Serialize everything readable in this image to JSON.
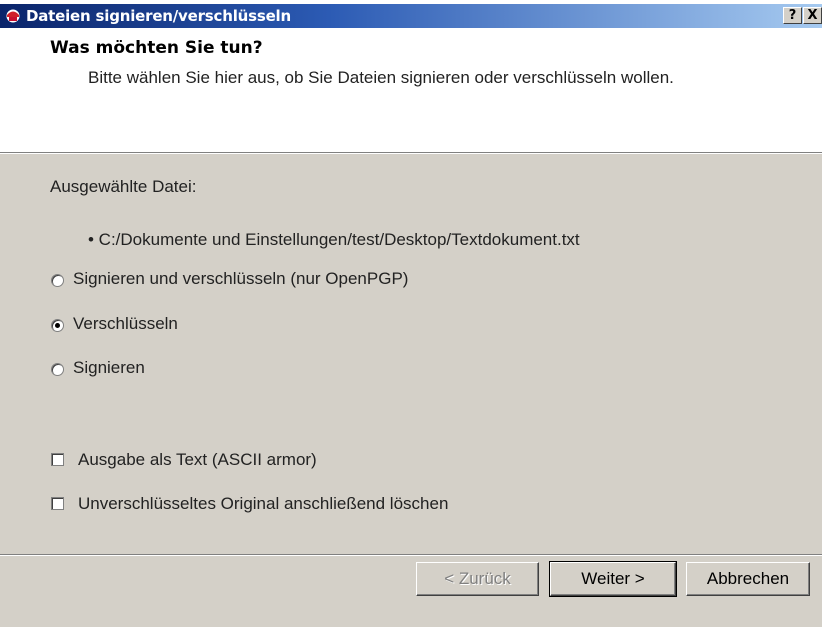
{
  "window": {
    "title": "Dateien signieren/verschlüsseln",
    "help_label": "?",
    "close_label": "X"
  },
  "header": {
    "title": "Was möchten Sie tun?",
    "subtitle": "Bitte wählen Sie hier aus, ob Sie Dateien signieren oder verschlüsseln wollen."
  },
  "files": {
    "label": "Ausgewählte Datei:",
    "items": [
      "• C:/Dokumente und Einstellungen/test/Desktop/Textdokument.txt"
    ]
  },
  "options": {
    "sign_encrypt": {
      "label": "Signieren und verschlüsseln (nur OpenPGP)",
      "selected": false
    },
    "encrypt": {
      "label": "Verschlüsseln",
      "selected": true
    },
    "sign": {
      "label": "Signieren",
      "selected": false
    }
  },
  "checkboxes": {
    "ascii_armor": {
      "label": "Ausgabe als Text (ASCII armor)",
      "checked": false
    },
    "delete_original": {
      "label": "Unverschlüsseltes Original anschließend löschen",
      "checked": false
    }
  },
  "buttons": {
    "back": "< Zurück",
    "next": "Weiter >",
    "cancel": "Abbrechen"
  },
  "colors": {
    "titlebar_start": "#0a246a",
    "titlebar_end": "#a6caf0",
    "dialog_bg": "#d4d0c8"
  }
}
